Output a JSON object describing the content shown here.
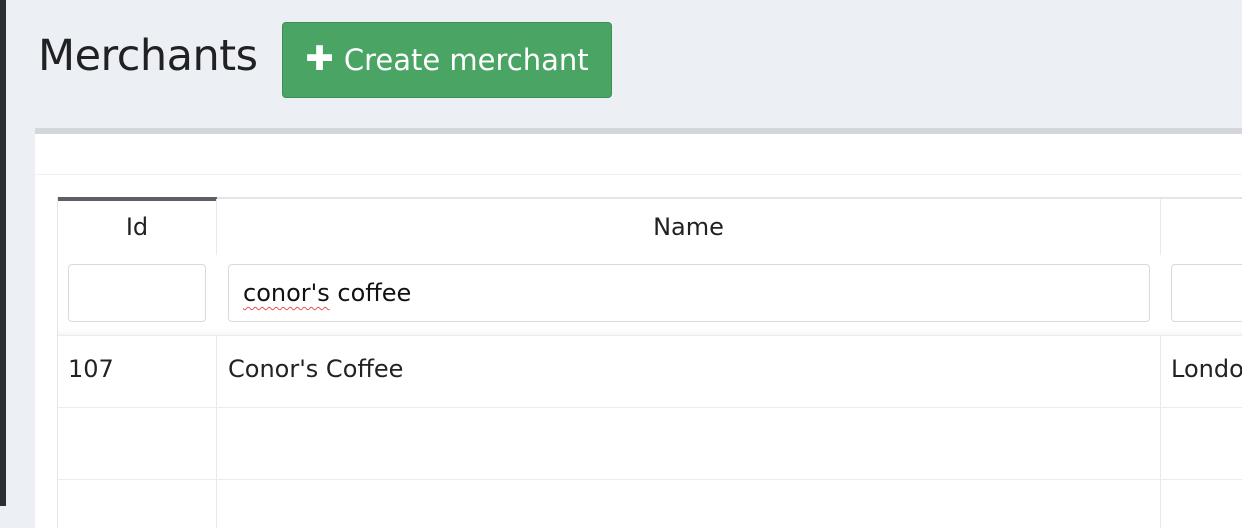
{
  "page": {
    "title": "Merchants"
  },
  "toolbar": {
    "create_label": "Create merchant",
    "create_icon": "plus-icon"
  },
  "table": {
    "columns": [
      "Id",
      "Name",
      ""
    ],
    "filters": {
      "id": "",
      "name_misspelled": "conor's",
      "name_rest": " coffee",
      "third": ""
    },
    "rows": [
      {
        "id": "107",
        "name": "Conor's Coffee",
        "location": "Londo"
      }
    ]
  },
  "colors": {
    "primary_button": "#4aa564",
    "background": "#eceff4"
  }
}
